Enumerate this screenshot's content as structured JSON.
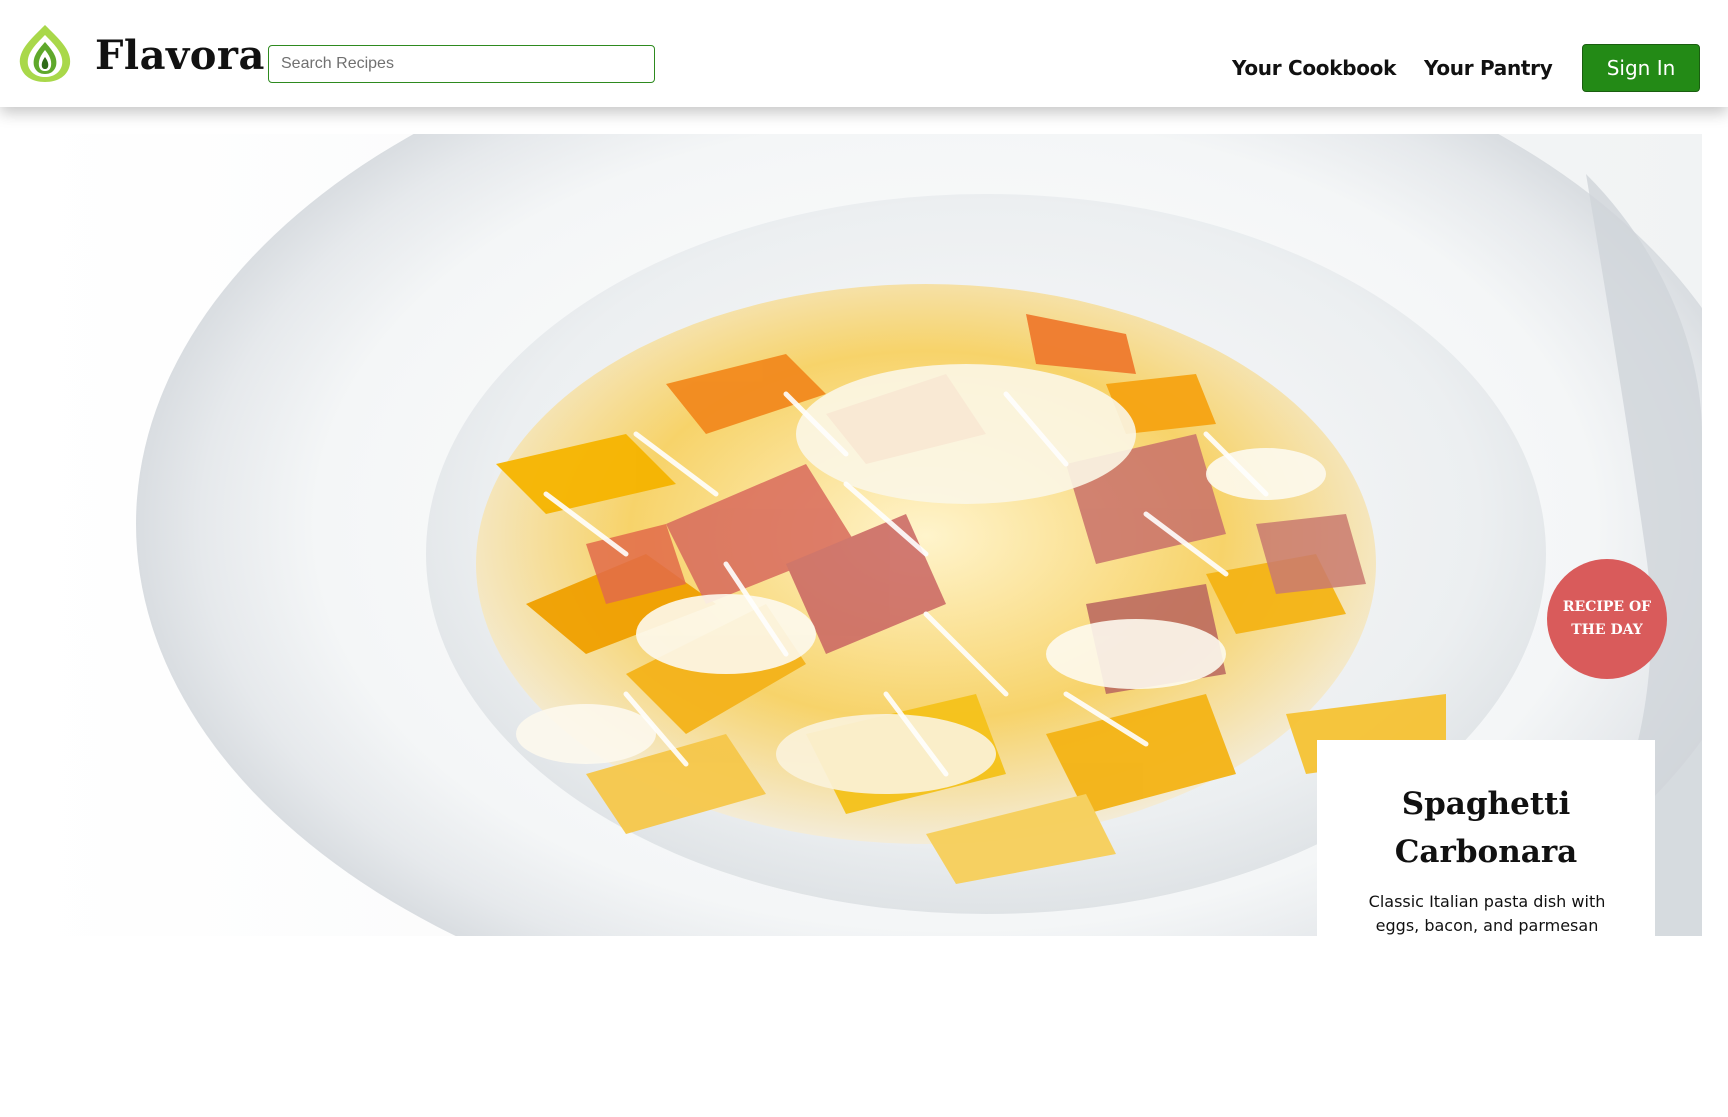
{
  "header": {
    "brand": "Flavora",
    "logo_icon": "leaf-flame-icon",
    "search": {
      "placeholder": "Search Recipes",
      "value": ""
    },
    "nav": {
      "cookbook": "Your Cookbook",
      "pantry": "Your Pantry"
    },
    "signin_label": "Sign In"
  },
  "hero": {
    "image": "pasta-dish-photo",
    "badge": "RECIPE OF THE DAY",
    "recipe_title": "Spaghetti Carbonara",
    "recipe_description": "Classic Italian pasta dish with eggs, bacon, and parmesan cheese"
  },
  "colors": {
    "accent_green": "#238a16",
    "badge_red": "#d95b5b",
    "logo_green": "#8cc63f"
  }
}
